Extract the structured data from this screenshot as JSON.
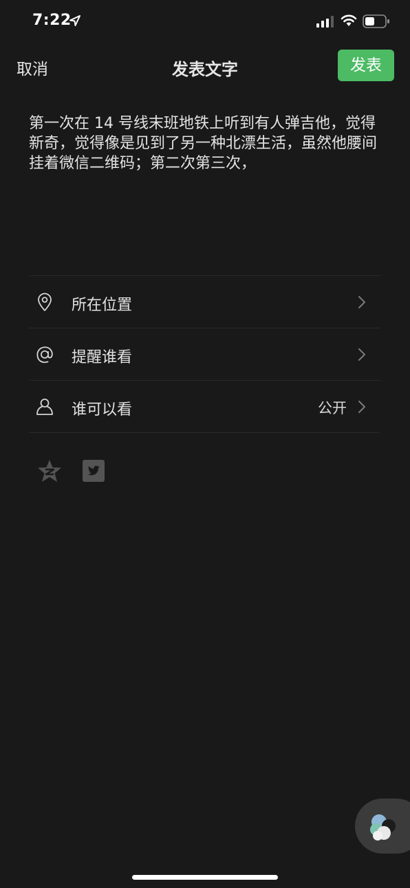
{
  "status_bar": {
    "time": "7:22"
  },
  "nav": {
    "cancel_label": "取消",
    "title": "发表文字",
    "publish_label": "发表"
  },
  "post": {
    "text": "第一次在 14 号线末班地铁上听到有人弹吉他，觉得新奇，觉得像是见到了另一种北漂生活，虽然他腰间挂着微信二维码；第二次第三次，"
  },
  "options": [
    {
      "label": "所在位置",
      "icon": "location-pin-icon",
      "value": ""
    },
    {
      "label": "提醒谁看",
      "icon": "at-icon",
      "value": ""
    },
    {
      "label": "谁可以看",
      "icon": "person-icon",
      "value": "公开"
    }
  ],
  "share": {
    "icons": [
      "qzone-icon",
      "twitter-icon"
    ]
  },
  "colors": {
    "background": "#191919",
    "accent_green": "#4cbb64",
    "text": "#e6e6e6",
    "divider": "#2a2a2a"
  }
}
